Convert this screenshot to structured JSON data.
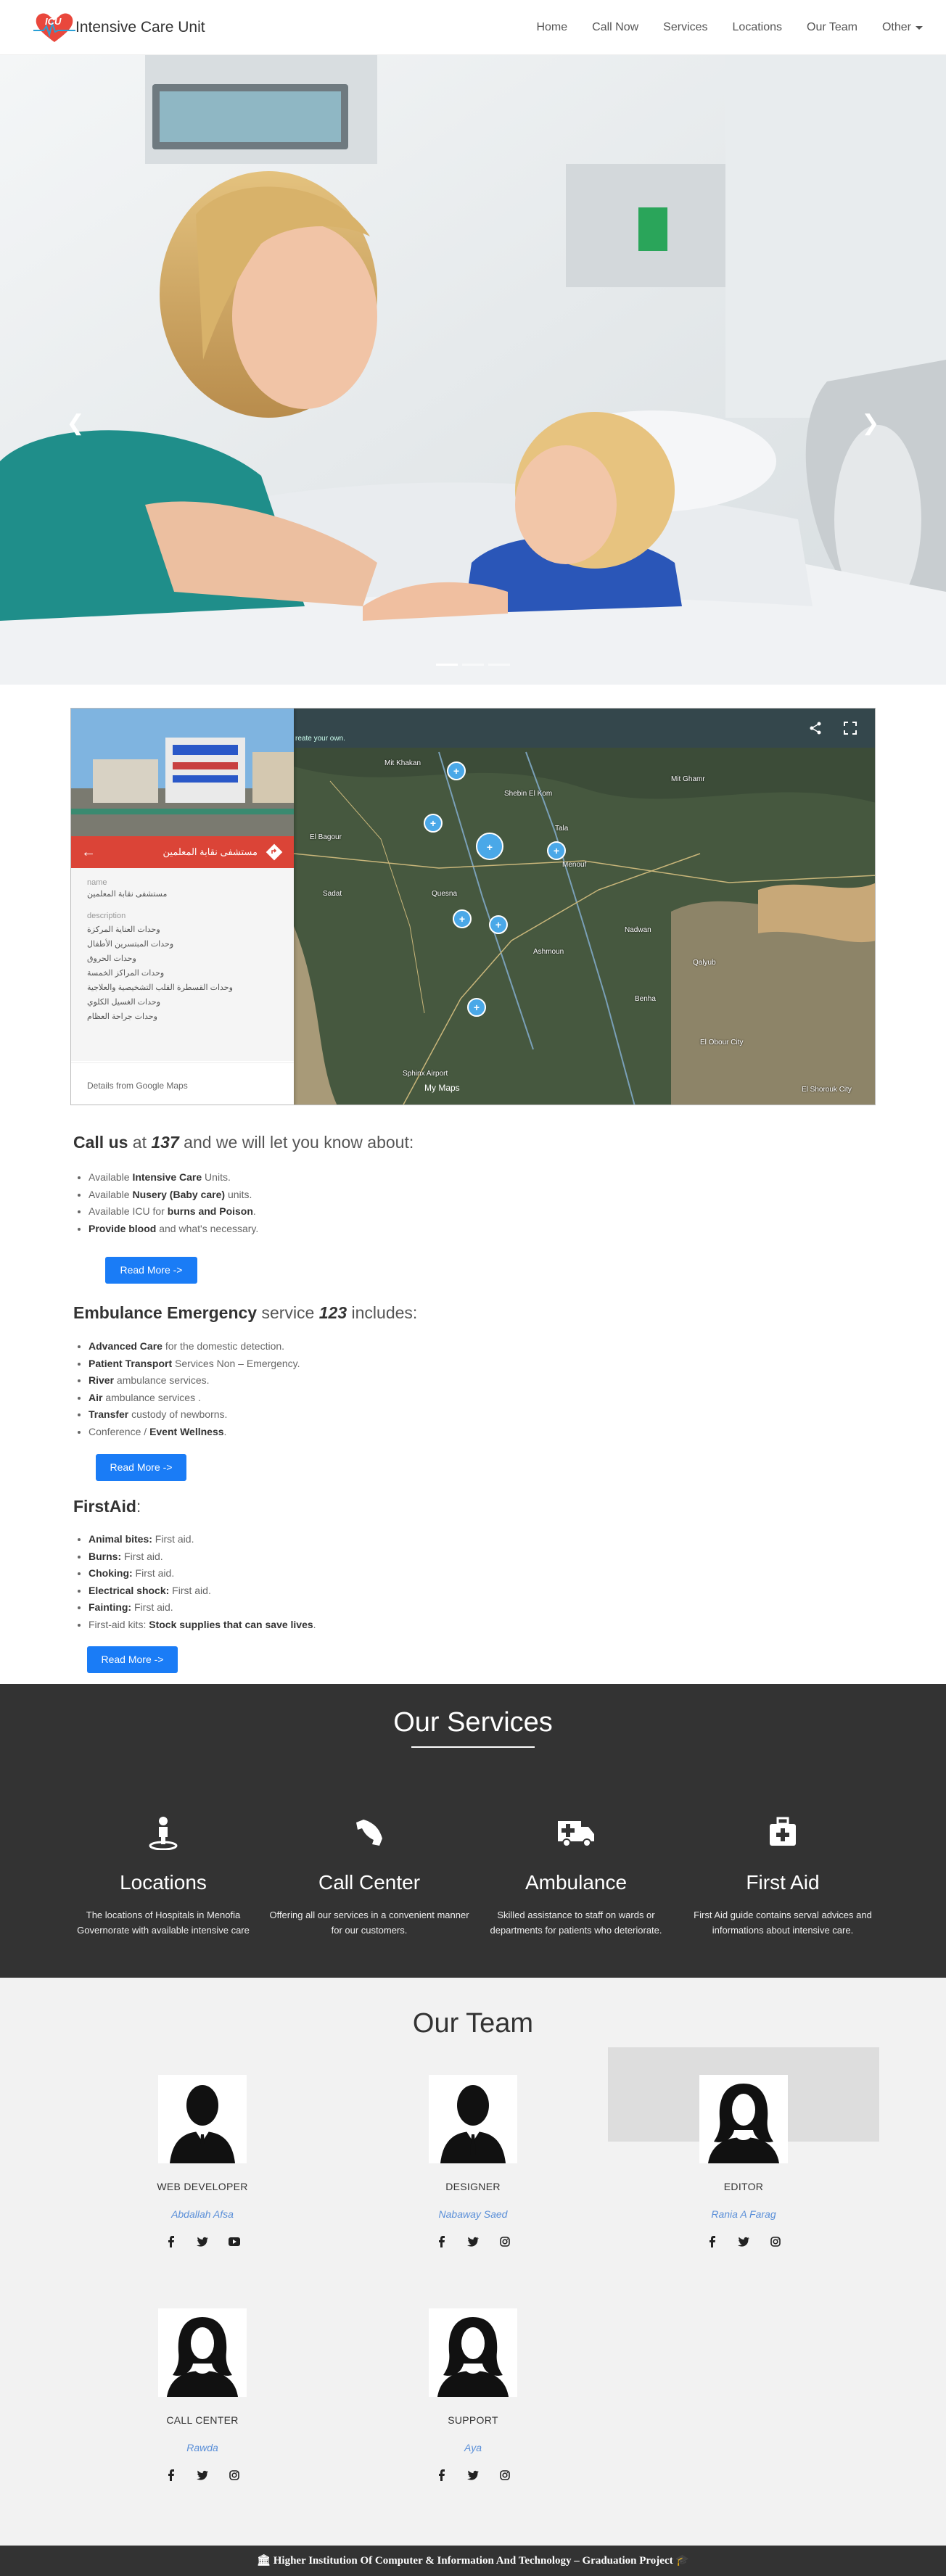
{
  "navbar": {
    "logo_text": "ICU",
    "brand": "Intensive Care Unit",
    "items": [
      {
        "label": "Home"
      },
      {
        "label": "Call Now"
      },
      {
        "label": "Services"
      },
      {
        "label": "Locations"
      },
      {
        "label": "Our Team"
      },
      {
        "label": "Other"
      }
    ]
  },
  "hero": {
    "prev_icon": "chevron-left-icon",
    "next_icon": "chevron-right-icon",
    "slide_count": 3,
    "active_slide": 1
  },
  "map": {
    "place_title": "مستشفى نقابة المعلمين",
    "name_label": "name",
    "name_value": "مستشفى نقابة المعلمين",
    "description_label": "description",
    "description_lines": [
      "وحدات العناية المركزة",
      "وحدات المبتسرين الأطفال",
      "وحدات الحروق",
      "وحدات المراكز الخمسة",
      "وحدات القسطرة القلب التشخيصية والعلاجية",
      "وحدات الغسيل الكلوي",
      "وحدات جراحة العظام"
    ],
    "footer": "Details from Google Maps",
    "hint": "reate your own.",
    "brand": "My Maps",
    "places": [
      "Mit Khakan",
      "Shebin El Kom",
      "Menouf",
      "Sadat",
      "Quesna",
      "Tala",
      "Nadwan",
      "Benha",
      "El Obour City",
      "Sphinx Airport",
      "Ashmoun",
      "El Bagour",
      "Mit Ghamr",
      "Qalyub",
      "El Shorouk City"
    ]
  },
  "call_us": {
    "prefix": "Call us",
    "at": " at ",
    "number": "137",
    "suffix": " and we will let you know about:",
    "items": [
      {
        "pre": "Available ",
        "bold": "Intensive Care",
        "post": " Units."
      },
      {
        "pre": "Available ",
        "bold": "Nusery (Baby care)",
        "post": " units."
      },
      {
        "pre": "Available ICU for ",
        "bold": "burns and Poison",
        "post": "."
      },
      {
        "pre": "",
        "bold": "Provide blood",
        "post": " and what's necessary."
      }
    ],
    "button": "Read More ->"
  },
  "ambulance": {
    "bold": "Embulance Emergency",
    "middle": " service ",
    "number": "123",
    "suffix": " includes:",
    "items": [
      {
        "pre": "",
        "bold": "Advanced Care",
        "post": " for the domestic detection."
      },
      {
        "pre": "",
        "bold": "Patient Transport",
        "post": " Services Non – Emergency."
      },
      {
        "pre": "",
        "bold": "River",
        "post": " ambulance services."
      },
      {
        "pre": "",
        "bold": "Air",
        "post": " ambulance services ."
      },
      {
        "pre": "",
        "bold": "Transfer",
        "post": " custody of newborns."
      },
      {
        "pre": "Conference / ",
        "bold": "Event Wellness",
        "post": "."
      }
    ],
    "button": "Read More ->"
  },
  "firstaid": {
    "bold": "FirstAid",
    "suffix": ":",
    "items": [
      {
        "pre": "",
        "bold": "Animal bites:",
        "post": " First aid."
      },
      {
        "pre": "",
        "bold": "Burns:",
        "post": " First aid."
      },
      {
        "pre": "",
        "bold": "Choking:",
        "post": " First aid."
      },
      {
        "pre": "",
        "bold": "Electrical shock:",
        "post": " First aid."
      },
      {
        "pre": "",
        "bold": "Fainting:",
        "post": " First aid."
      },
      {
        "pre": "First-aid kits: ",
        "bold": "Stock supplies that can save lives",
        "post": "."
      }
    ],
    "button": "Read More ->"
  },
  "services": {
    "heading": "Our Services",
    "items": [
      {
        "icon": "location-person-icon",
        "title": "Locations",
        "desc": "The locations of Hospitals in Menofia Governorate with available intensive care"
      },
      {
        "icon": "phone-icon",
        "title": "Call Center",
        "desc": "Offering all our services in a convenient manner for our customers."
      },
      {
        "icon": "ambulance-icon",
        "title": "Ambulance",
        "desc": "Skilled assistance to staff on wards or departments for patients who deteriorate."
      },
      {
        "icon": "first-aid-kit-icon",
        "title": "First Aid",
        "desc": "First Aid guide contains serval advices and informations about intensive care."
      }
    ]
  },
  "team": {
    "heading": "Our Team",
    "members": [
      {
        "role": "Web Developer",
        "name": "Abdallah Afsa",
        "gender": "male",
        "socials": [
          "facebook-icon",
          "twitter-icon",
          "youtube-icon"
        ]
      },
      {
        "role": "Designer",
        "name": "Nabaway Saed",
        "gender": "male",
        "socials": [
          "facebook-icon",
          "twitter-icon",
          "instagram-icon"
        ]
      },
      {
        "role": "Editor",
        "name": "Rania A Farag",
        "gender": "female",
        "socials": [
          "facebook-icon",
          "twitter-icon",
          "instagram-icon"
        ]
      },
      {
        "role": "Call Center",
        "name": "Rawda",
        "gender": "female",
        "socials": [
          "facebook-icon",
          "twitter-icon",
          "instagram-icon"
        ]
      },
      {
        "role": "Support",
        "name": "Aya",
        "gender": "female",
        "socials": [
          "facebook-icon",
          "twitter-icon",
          "instagram-icon"
        ]
      }
    ]
  },
  "footer": {
    "text": "🏛 Higher Institution Of Computer & Information And Technology – Graduation Project 🎓"
  },
  "colors": {
    "primary": "#1a7cf6",
    "dark": "#333333",
    "map_red": "#db4437",
    "link": "#5a8fd8"
  }
}
